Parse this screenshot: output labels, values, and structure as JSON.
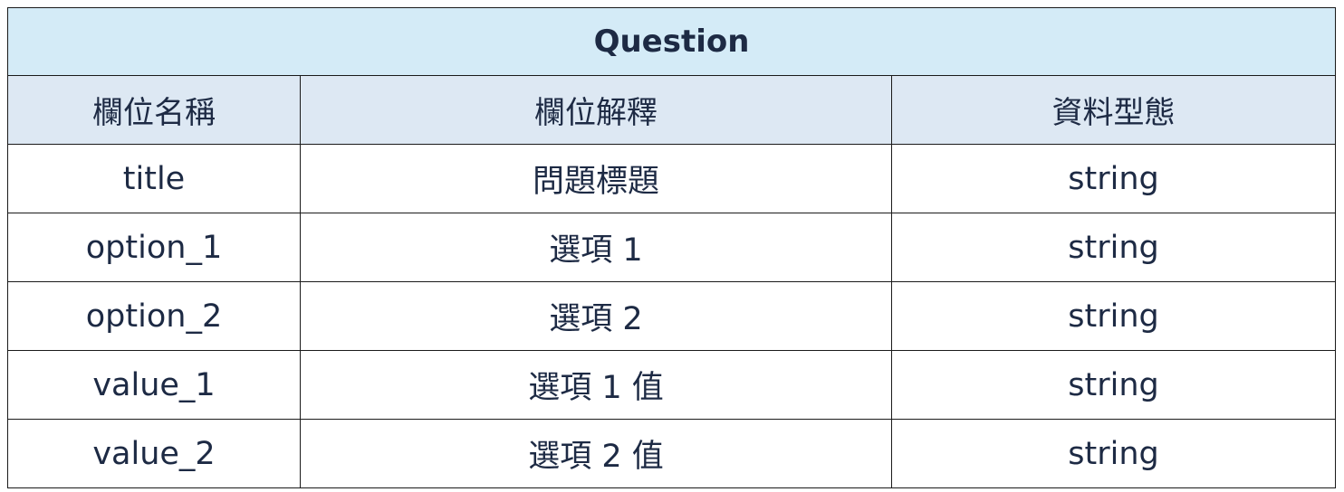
{
  "table": {
    "title": "Question",
    "headers": [
      "欄位名稱",
      "欄位解釋",
      "資料型態"
    ],
    "rows": [
      [
        "title",
        "問題標題",
        "string"
      ],
      [
        "option_1",
        "選項 1",
        "string"
      ],
      [
        "option_2",
        "選項 2",
        "string"
      ],
      [
        "value_1",
        "選項 1 值",
        "string"
      ],
      [
        "value_2",
        "選項 2 值",
        "string"
      ]
    ],
    "colors": {
      "title_bg": "#d4ebf7",
      "header_bg": "#dde8f3",
      "border": "#1a1a1a",
      "text": "#1d2a44"
    }
  }
}
